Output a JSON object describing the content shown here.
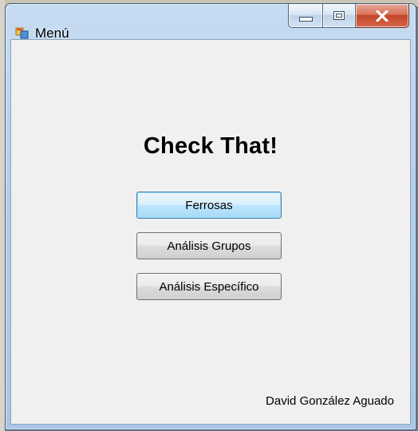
{
  "window": {
    "title": "Menú"
  },
  "main": {
    "heading": "Check That!",
    "buttons": [
      {
        "label": "Ferrosas",
        "focused": true
      },
      {
        "label": "Análisis Grupos"
      },
      {
        "label": "Análisis Específico"
      }
    ],
    "author": "David González Aguado"
  },
  "icons": {
    "app": "window-app-icon",
    "minimize": "minimize-icon",
    "maximize": "maximize-icon",
    "close": "close-icon"
  },
  "colors": {
    "client_bg": "#f0f0f0",
    "close_button": "#c4462a",
    "focus_border": "#3c7fb1"
  }
}
